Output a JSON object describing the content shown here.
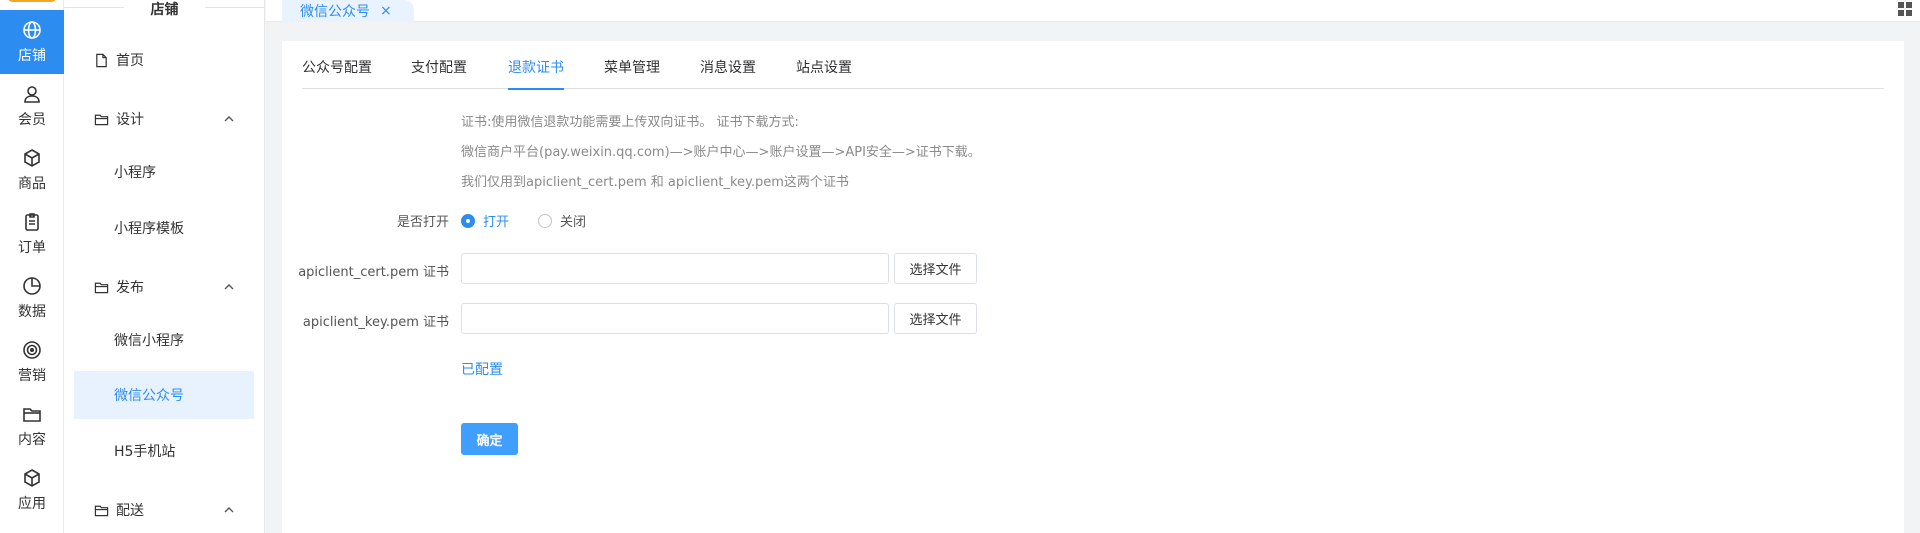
{
  "rail": {
    "items": [
      {
        "label": "店铺",
        "icon": "globe-icon",
        "active": true
      },
      {
        "label": "会员",
        "icon": "user-icon"
      },
      {
        "label": "商品",
        "icon": "cube-icon"
      },
      {
        "label": "订单",
        "icon": "clipboard-icon"
      },
      {
        "label": "数据",
        "icon": "pie-chart-icon"
      },
      {
        "label": "营销",
        "icon": "target-icon"
      },
      {
        "label": "内容",
        "icon": "folder-icon"
      },
      {
        "label": "应用",
        "icon": "package-icon"
      }
    ]
  },
  "submenu": {
    "title": "店铺",
    "items": [
      {
        "label": "首页",
        "type": "page",
        "icon": "file-icon"
      },
      {
        "label": "设计",
        "type": "group",
        "icon": "folder-icon"
      },
      {
        "label": "小程序",
        "type": "child"
      },
      {
        "label": "小程序模板",
        "type": "child"
      },
      {
        "label": "发布",
        "type": "group",
        "icon": "folder-icon"
      },
      {
        "label": "微信小程序",
        "type": "child"
      },
      {
        "label": "微信公众号",
        "type": "child",
        "active": true
      },
      {
        "label": "H5手机站",
        "type": "child"
      },
      {
        "label": "配送",
        "type": "group",
        "icon": "folder-icon"
      }
    ]
  },
  "tabbar": {
    "tab_label": "微信公众号",
    "close_glyph": "×"
  },
  "content_tabs": [
    "公众号配置",
    "支付配置",
    "退款证书",
    "菜单管理",
    "消息设置",
    "站点设置"
  ],
  "content_tabs_active": "退款证书",
  "tips": {
    "line1": "证书:使用微信退款功能需要上传双向证书。 证书下载方式:",
    "line2": "微信商户平台(pay.weixin.qq.com)—>账户中心—>账户设置—>API安全—>证书下载。",
    "line3": "我们仅用到apiclient_cert.pem 和 apiclient_key.pem这两个证书"
  },
  "form": {
    "open_label": "是否打开",
    "open_option": "打开",
    "close_option": "关闭",
    "cert_label": "apiclient_cert.pem 证书",
    "key_label": "apiclient_key.pem 证书",
    "cert_value": "",
    "key_value": "",
    "choose_file": "选择文件",
    "configured": "已配置",
    "confirm": "确定"
  },
  "colors": {
    "accent": "#2d8cf0",
    "button": "#409eff",
    "active_bg": "#e7f2fe",
    "rail_chip": "#f5a623"
  }
}
